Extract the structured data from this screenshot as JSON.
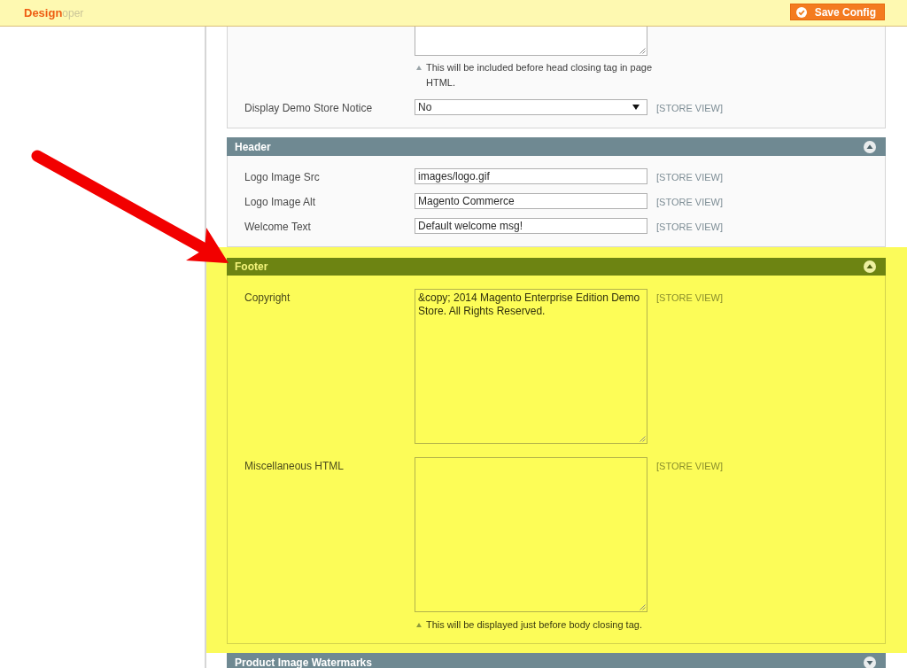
{
  "top_bar": {
    "title": "Design",
    "faded_text": "oper",
    "save_button": "Save Config"
  },
  "sections": [
    {
      "fields": [
        {
          "kind": "cut-textarea",
          "hint": "This will be included before head closing tag in page HTML."
        },
        {
          "kind": "select",
          "label": "Display Demo Store Notice",
          "value": "No",
          "scope": "[STORE VIEW]"
        }
      ]
    },
    {
      "title": "Header",
      "expanded": true,
      "fields": [
        {
          "kind": "text",
          "label": "Logo Image Src",
          "value": "images/logo.gif",
          "scope": "[STORE VIEW]"
        },
        {
          "kind": "text",
          "label": "Logo Image Alt",
          "value": "Magento Commerce",
          "scope": "[STORE VIEW]"
        },
        {
          "kind": "text",
          "label": "Welcome Text",
          "value": "Default welcome msg!",
          "scope": "[STORE VIEW]"
        }
      ]
    },
    {
      "title": "Footer",
      "expanded": true,
      "highlighted": true,
      "fields": [
        {
          "kind": "textarea",
          "label": "Copyright",
          "value": "&copy; 2014 Magento Enterprise Edition Demo Store. All Rights Reserved.",
          "scope": "[STORE VIEW]"
        },
        {
          "kind": "textarea",
          "label": "Miscellaneous HTML",
          "scope": "[STORE VIEW]",
          "hint": "This will be displayed just before body closing tag."
        }
      ]
    },
    {
      "title": "Product Image Watermarks",
      "expanded": false
    }
  ]
}
